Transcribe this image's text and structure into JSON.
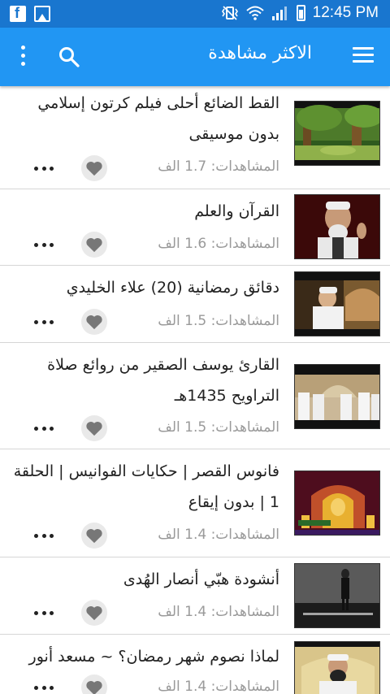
{
  "status_bar": {
    "time": "12:45 PM",
    "left_icons": [
      "facebook-icon",
      "gallery-icon"
    ],
    "right_icons": [
      "vibrate-icon",
      "wifi-icon",
      "signal-icon",
      "battery-icon"
    ]
  },
  "app_bar": {
    "title": "الاكثر مشاهدة",
    "menu_icon": "hamburger-menu-icon",
    "search_icon": "search-icon",
    "more_icon": "overflow-menu-icon",
    "color": "#2196f3"
  },
  "videos": [
    {
      "title": "القط الضائع أحلى فيلم كرتون إسلامي بدون موسيقى",
      "views": "المشاهدات: 1.7 الف",
      "thumbnail": "cartoon-forest-thumbnail"
    },
    {
      "title": "القرآن والعلم",
      "views": "المشاهدات: 1.6 الف",
      "thumbnail": "sheikh-speaker-thumbnail"
    },
    {
      "title": "دقائق رمضانية (20) علاء الخليدي",
      "views": "المشاهدات: 1.5 الف",
      "thumbnail": "preacher-mosque-thumbnail"
    },
    {
      "title": "القارئ يوسف الصقير من روائع صلاة التراويح 1435هـ",
      "views": "المشاهدات: 1.5 الف",
      "thumbnail": "prayer-congregation-thumbnail"
    },
    {
      "title": "فانوس القصر | حكايات الفوانيس | الحلقة 1 | بدون إيقاع",
      "views": "المشاهدات: 1.4 الف",
      "thumbnail": "lantern-show-thumbnail"
    },
    {
      "title": "أنشودة هبّي أنصار الهُدى",
      "views": "المشاهدات: 1.4 الف",
      "thumbnail": "nasheed-walking-thumbnail"
    },
    {
      "title": "لماذا نصوم شهر رمضان؟ ~ مسعد أنور",
      "views": "المشاهدات: 1.4 الف",
      "thumbnail": "sheikh-lecture-thumbnail"
    }
  ]
}
